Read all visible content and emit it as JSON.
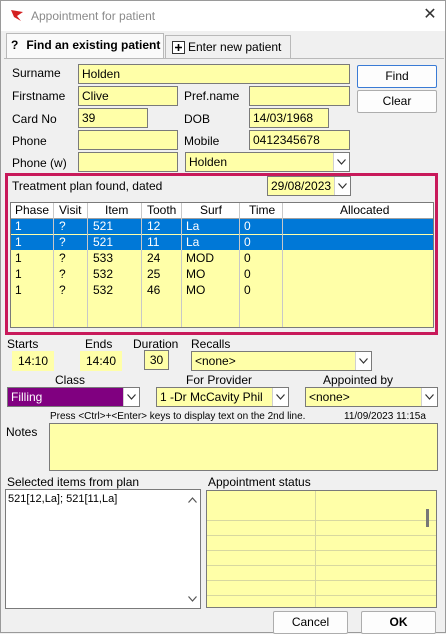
{
  "window": {
    "title": "Appointment for patient",
    "close_glyph": "✕"
  },
  "tabs": [
    {
      "label": "Find an existing patient",
      "icon": "question-icon"
    },
    {
      "label": "Enter new patient",
      "icon": "new-document-icon"
    }
  ],
  "patient": {
    "surname_label": "Surname",
    "surname": "Holden",
    "firstname_label": "Firstname",
    "firstname": "Clive",
    "prefname_label": "Pref.name",
    "prefname": "",
    "cardno_label": "Card No",
    "cardno": "39",
    "dob_label": "DOB",
    "dob": "14/03/1968",
    "phone_label": "Phone",
    "phone": "",
    "mobile_label": "Mobile",
    "mobile": "0412345678",
    "phonew_label": "Phone (w)",
    "phonew": "",
    "family_select": "Holden"
  },
  "buttons": {
    "find": "Find",
    "clear": "Clear",
    "cancel": "Cancel",
    "ok": "OK"
  },
  "plan": {
    "found_label": "Treatment plan found, dated",
    "date": "29/08/2023",
    "columns": [
      "Phase",
      "Visit",
      "Item",
      "Tooth",
      "Surf",
      "Time",
      "Allocated"
    ],
    "rows": [
      {
        "phase": "1",
        "visit": "?",
        "item": "521",
        "tooth": "12",
        "surf": "La",
        "time": "0",
        "allocated": "",
        "selected": true
      },
      {
        "phase": "1",
        "visit": "?",
        "item": "521",
        "tooth": "11",
        "surf": "La",
        "time": "0",
        "allocated": "",
        "selected": true
      },
      {
        "phase": "1",
        "visit": "?",
        "item": "533",
        "tooth": "24",
        "surf": "MOD",
        "time": "0",
        "allocated": "",
        "selected": false
      },
      {
        "phase": "1",
        "visit": "?",
        "item": "532",
        "tooth": "25",
        "surf": "MO",
        "time": "0",
        "allocated": "",
        "selected": false
      },
      {
        "phase": "1",
        "visit": "?",
        "item": "532",
        "tooth": "46",
        "surf": "MO",
        "time": "0",
        "allocated": "",
        "selected": false
      }
    ]
  },
  "appointment": {
    "starts_label": "Starts",
    "starts": "14:10",
    "ends_label": "Ends",
    "ends": "14:40",
    "duration_label": "Duration",
    "duration": "30",
    "recalls_label": "Recalls",
    "recalls": "<none>",
    "class_label": "Class",
    "class_value": "Filling",
    "class_color": "#800080",
    "provider_label": "For Provider",
    "provider": "1 -Dr McCavity Phil",
    "appointed_label": "Appointed by",
    "appointed": "<none>",
    "hint": "Press <Ctrl>+<Enter> keys to display text on the 2nd line.",
    "timestamp": "11/09/2023 11:15a",
    "notes_label": "Notes",
    "notes": ""
  },
  "selected_items": {
    "label": "Selected items from plan",
    "text": "521[12,La]; 521[11,La]"
  },
  "status": {
    "label": "Appointment status"
  },
  "colors": {
    "field_bg": "#ffffa8",
    "selection": "#0078d7",
    "highlight_frame": "#c8195a"
  }
}
